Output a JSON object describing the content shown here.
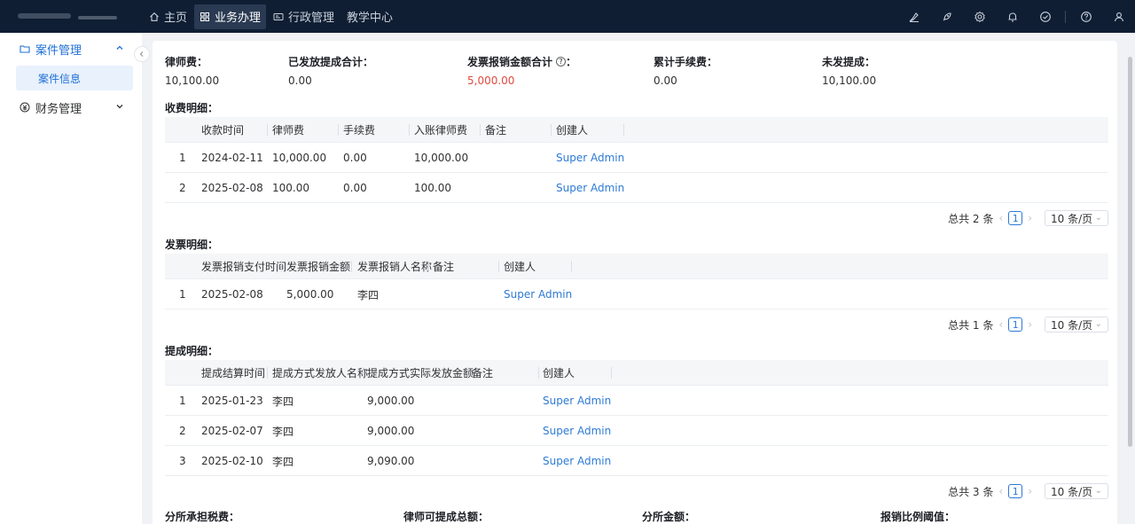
{
  "topnav": {
    "items": [
      {
        "label": "主页",
        "icon": "home-icon"
      },
      {
        "label": "业务办理",
        "icon": "grid-icon",
        "active": true
      },
      {
        "label": "行政管理",
        "icon": "id-card-icon"
      },
      {
        "label": "教学中心"
      }
    ],
    "tools": [
      "brush-icon",
      "rocket-icon",
      "gear-icon",
      "bell-icon",
      "check-circle-icon",
      "help-icon",
      "user-icon"
    ]
  },
  "sidebar": {
    "case_mgmt": "案件管理",
    "case_info": "案件信息",
    "finance_mgmt": "财务管理"
  },
  "summary": [
    {
      "label": "律师费：",
      "value": "10,100.00"
    },
    {
      "label": "已发放提成合计：",
      "value": "0.00"
    },
    {
      "label": "发票报销金额合计",
      "suffix": "：",
      "value": "5,000.00",
      "highlight": "#e04a3c"
    },
    {
      "label": "累计手续费：",
      "value": "0.00"
    },
    {
      "label": "未发提成：",
      "value": "10,100.00"
    }
  ],
  "fees": {
    "title": "收费明细：",
    "headers": [
      "收款时间",
      "律师费",
      "手续费",
      "入账律师费",
      "备注",
      "创建人"
    ],
    "rows": [
      [
        "1",
        "2024-02-11",
        "10,000.00",
        "0.00",
        "10,000.00",
        "",
        "Super Admin"
      ],
      [
        "2",
        "2025-02-08",
        "100.00",
        "0.00",
        "100.00",
        "",
        "Super Admin"
      ]
    ],
    "pager": {
      "total": "总共 2 条",
      "page": "1",
      "size": "10 条/页"
    }
  },
  "invoices": {
    "title": "发票明细：",
    "headers": [
      "发票报销支付时间",
      "发票报销金额",
      "发票报销人名称",
      "备注",
      "创建人"
    ],
    "rows": [
      [
        "1",
        "2025-02-08",
        "5,000.00",
        "李四",
        "",
        "Super Admin"
      ]
    ],
    "pager": {
      "total": "总共 1 条",
      "page": "1",
      "size": "10 条/页"
    }
  },
  "commissions": {
    "title": "提成明细：",
    "headers": [
      "提成结算时间",
      "提成方式发放人名称",
      "提成方式实际发放金额",
      "备注",
      "创建人"
    ],
    "rows": [
      [
        "1",
        "2025-01-23",
        "李四",
        "9,000.00",
        "",
        "Super Admin"
      ],
      [
        "2",
        "2025-02-07",
        "李四",
        "9,000.00",
        "",
        "Super Admin"
      ],
      [
        "3",
        "2025-02-10",
        "李四",
        "9,090.00",
        "",
        "Super Admin"
      ]
    ],
    "pager": {
      "total": "总共 3 条",
      "page": "1",
      "size": "10 条/页"
    }
  },
  "bottom": [
    "分所承担税费：",
    "律师可提成总额：",
    "分所金额：",
    "报销比例阈值："
  ]
}
